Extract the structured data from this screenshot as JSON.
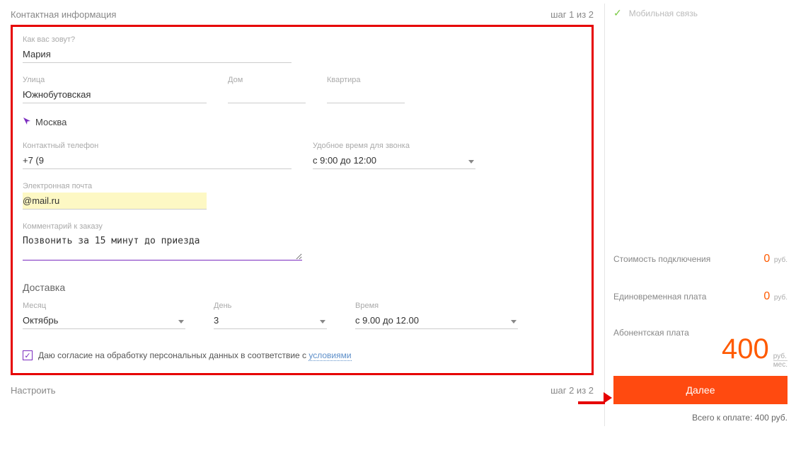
{
  "header": {
    "title": "Контактная информация",
    "step": "шаг 1 из 2"
  },
  "form": {
    "name_label": "Как вас зовут?",
    "name_value": "Мария",
    "street_label": "Улица",
    "street_value": "Южнобутовская",
    "house_label": "Дом",
    "house_value": "",
    "apt_label": "Квартира",
    "apt_value": "",
    "city": "Москва",
    "phone_label": "Контактный телефон",
    "phone_value": "+7 (9",
    "calltime_label": "Удобное время для звонка",
    "calltime_value": "с 9:00 до 12:00",
    "email_label": "Электронная почта",
    "email_value": "@mail.ru",
    "comment_label": "Комментарий к заказу",
    "comment_value": "Позвонить за 15 минут до приезда"
  },
  "delivery": {
    "title": "Доставка",
    "month_label": "Месяц",
    "month_value": "Октябрь",
    "day_label": "День",
    "day_value": "3",
    "time_label": "Время",
    "time_value": "с 9.00 до 12.00"
  },
  "consent": {
    "text": "Даю согласие на обработку персональных данных в соответствие с ",
    "link": "условиями"
  },
  "footer": {
    "title": "Настроить",
    "step": "шаг 2 из 2"
  },
  "sidebar": {
    "mobile_label": "Мобильная связь",
    "cost_connect_label": "Стоимость подключения",
    "cost_connect_value": "0",
    "cost_once_label": "Единовременная плата",
    "cost_once_value": "0",
    "fee_label": "Абонентская плата",
    "fee_value": "400",
    "unit_rub": "руб.",
    "unit_month": "мес.",
    "next_button": "Далее",
    "total": "Всего к оплате: 400 руб."
  }
}
